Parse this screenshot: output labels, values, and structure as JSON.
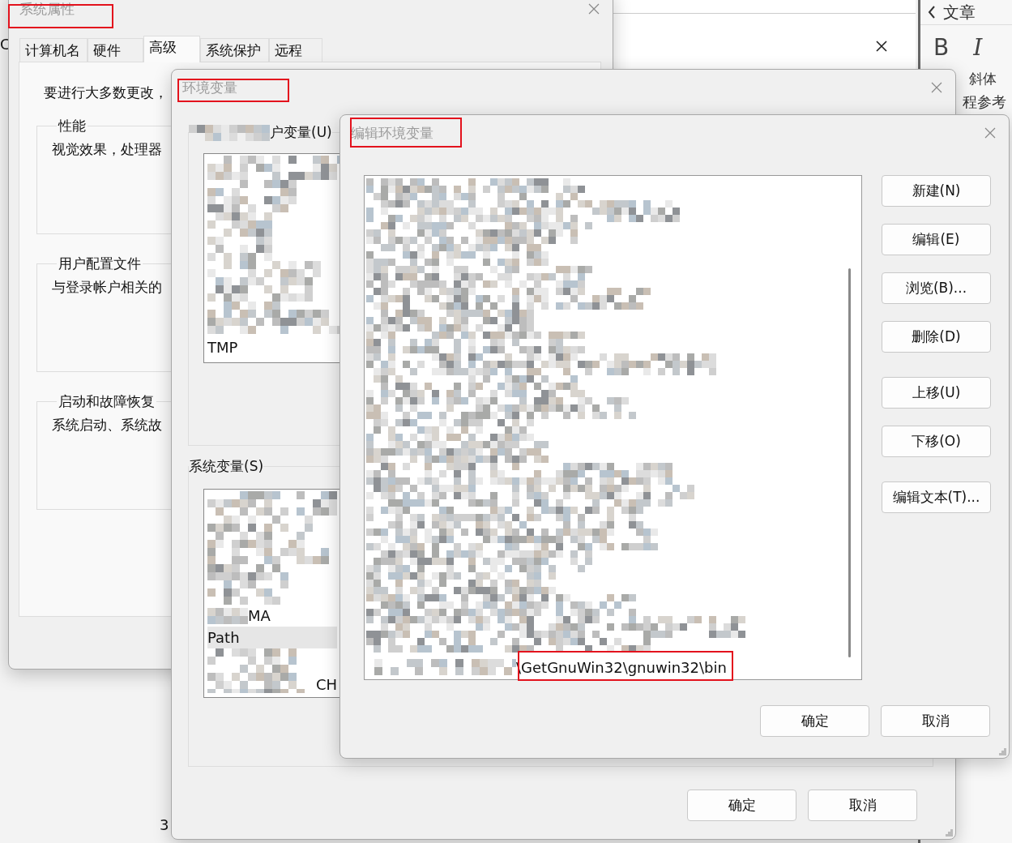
{
  "background_app": {
    "header_text": "文章",
    "toolbar": [
      {
        "label": "B",
        "kind": "bold"
      },
      {
        "label": "I",
        "kind": "italic"
      }
    ],
    "toolbar_caption": "斜体",
    "body_fragment": "程参考"
  },
  "desktop_fragments": {
    "left_letter": "C",
    "bottom_digit": "3"
  },
  "system_properties": {
    "title": "系统属性",
    "tabs": [
      {
        "label": "计算机名",
        "selected": false
      },
      {
        "label": "硬件",
        "selected": false
      },
      {
        "label": "高级",
        "selected": true
      },
      {
        "label": "系统保护",
        "selected": false
      },
      {
        "label": "远程",
        "selected": false
      }
    ],
    "intro": "要进行大多数更改，",
    "groups": [
      {
        "title": "性能",
        "text": "视觉效果，处理器"
      },
      {
        "title": "用户配置文件",
        "text": "与登录帐户相关的"
      },
      {
        "title": "启动和故障恢复",
        "text": "系统启动、系统故"
      }
    ]
  },
  "environment_variables": {
    "title": "环境变量",
    "user_variables": {
      "label": "户变量(U)",
      "rows": [
        {
          "name": "TMP",
          "selected": false
        }
      ]
    },
    "system_variables": {
      "label": "系统变量(S)",
      "rows": [
        {
          "name": "MA",
          "selected": false,
          "kind": "partly_hidden"
        },
        {
          "name": "Path",
          "selected": true,
          "kind": "plain"
        }
      ],
      "fragment": "CH"
    },
    "buttons": [
      "确定",
      "取消"
    ]
  },
  "edit_variable": {
    "title": "编辑环境变量",
    "last_entry": "\\GetGnuWin32\\gnuwin32\\bin",
    "side_button_groups": [
      [
        "新建(N)",
        "编辑(E)",
        "浏览(B)...",
        "删除(D)"
      ],
      [
        "上移(U)",
        "下移(O)"
      ],
      [
        "编辑文本(T)..."
      ]
    ],
    "buttons": [
      "确定",
      "取消"
    ]
  }
}
